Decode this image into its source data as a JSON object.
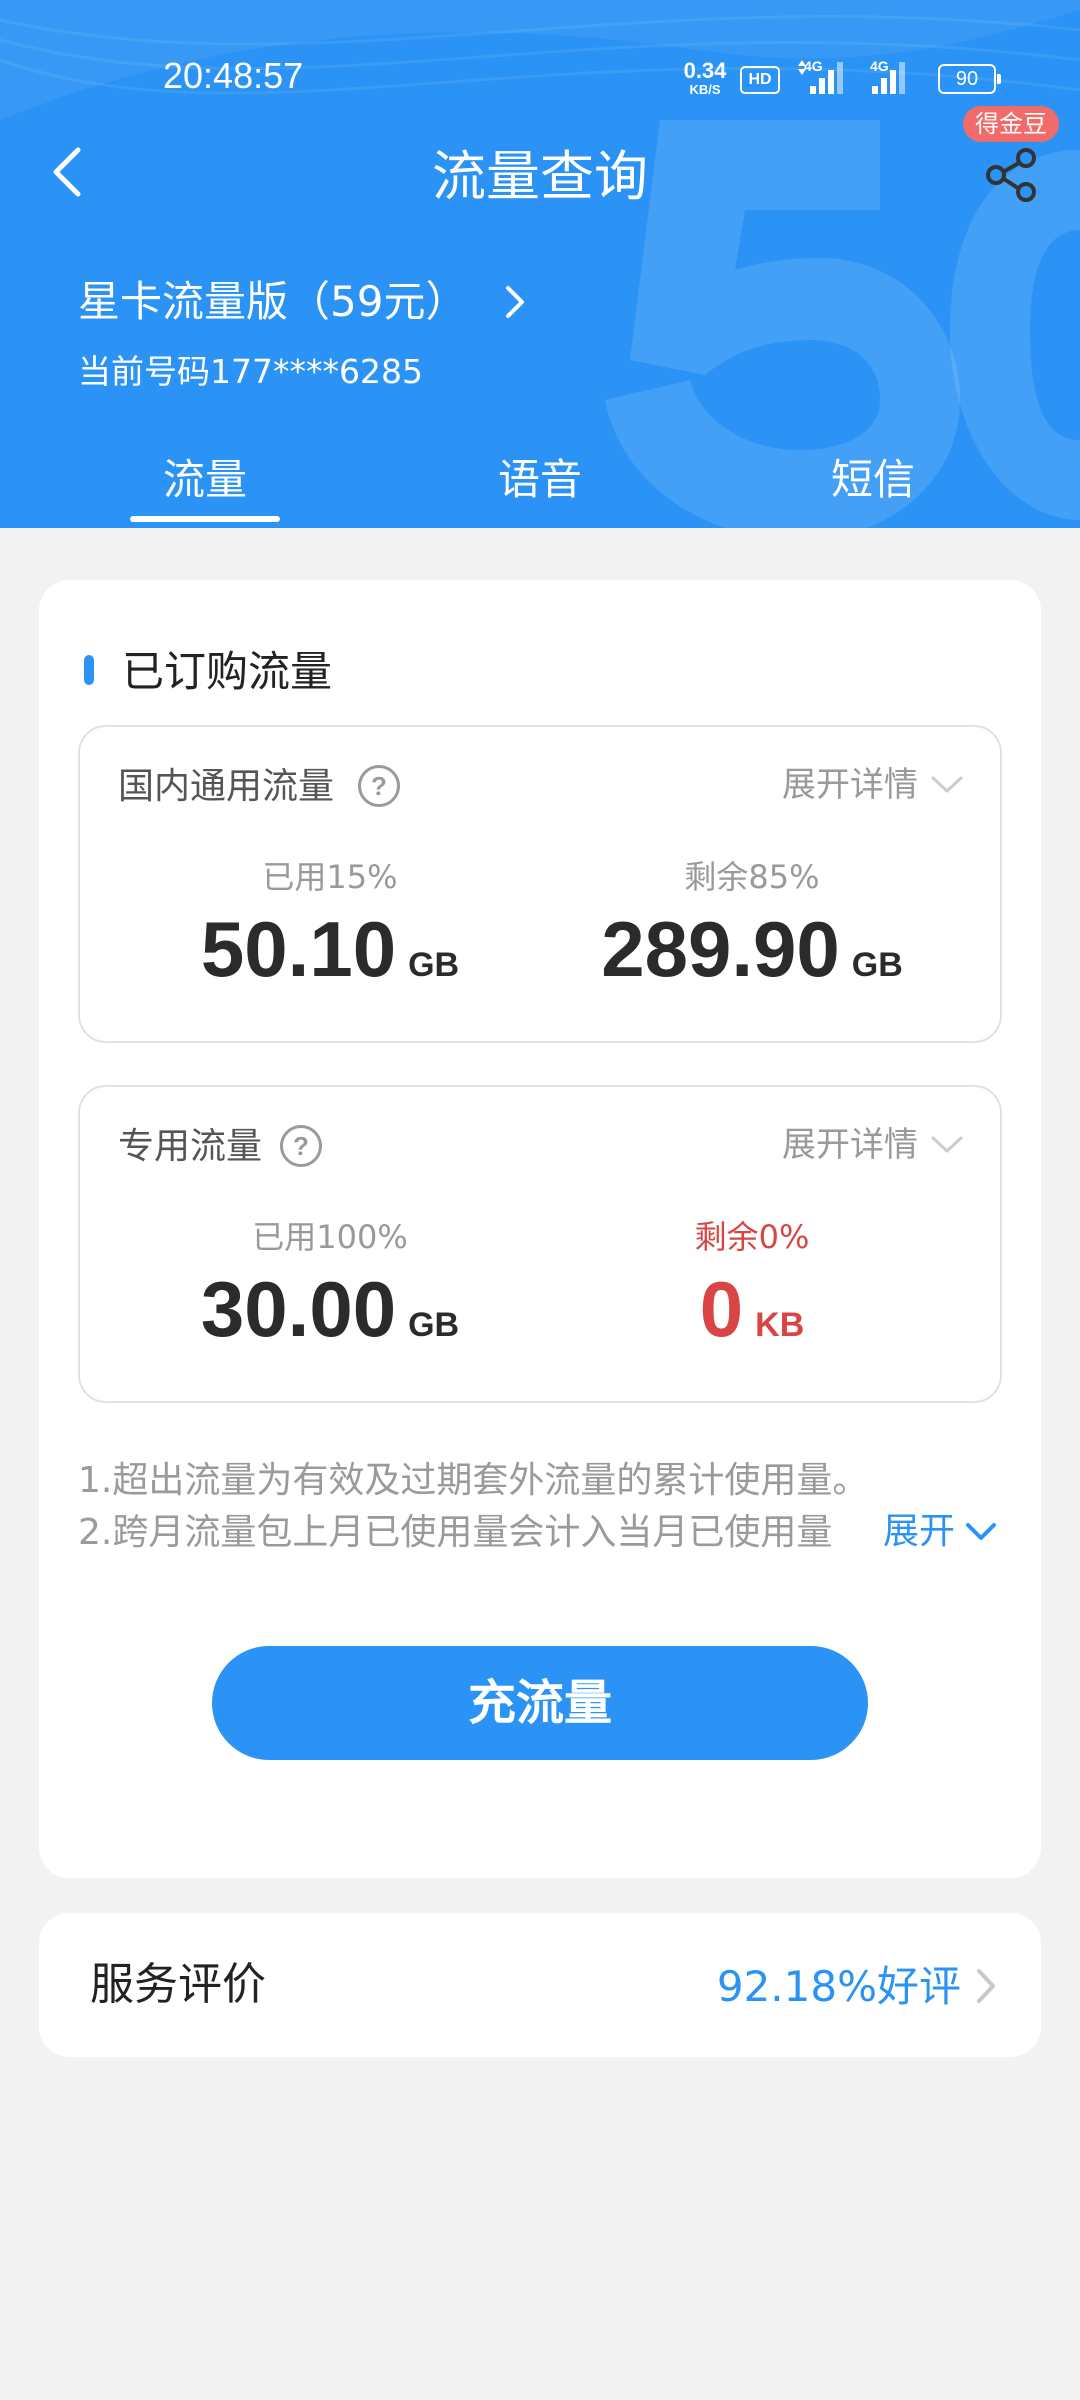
{
  "status_bar": {
    "time": "20:48:57",
    "net_speed_value": "0.34",
    "net_speed_unit": "KB/S",
    "hd_label": "HD",
    "signal_1_label": "4G",
    "signal_2_label": "4G",
    "battery": "90"
  },
  "header": {
    "title": "流量查询",
    "coin_badge": "得金豆",
    "plan_name": "星卡流量版（59元）",
    "phone_number": "当前号码177****6285",
    "tabs": [
      {
        "label": "流量",
        "active": true
      },
      {
        "label": "语音",
        "active": false
      },
      {
        "label": "短信",
        "active": false
      }
    ],
    "colors": {
      "primary": "#2b93f5",
      "badge": "#f26b6b"
    }
  },
  "subscribed": {
    "section_title": "已订购流量",
    "domestic": {
      "title": "国内通用流量",
      "expand_label": "展开详情",
      "used_label": "已用15%",
      "used_value": "50.10",
      "used_unit": "GB",
      "remaining_label": "剩余85%",
      "remaining_value": "289.90",
      "remaining_unit": "GB"
    },
    "dedicated": {
      "title": "专用流量",
      "expand_label": "展开详情",
      "used_label": "已用100%",
      "used_value": "30.00",
      "used_unit": "GB",
      "remaining_label": "剩余0%",
      "remaining_value": "0",
      "remaining_unit": "KB",
      "alert_color": "#d94545"
    }
  },
  "notes": {
    "line1": "1.超出流量为有效及过期套外流量的累计使用量。",
    "line2": "2.跨月流量包上月已使用量会计入当月已使用量",
    "expand_label": "展开"
  },
  "recharge_button": "充流量",
  "rating": {
    "title": "服务评价",
    "value": "92.18%好评"
  },
  "icons": [
    "back-icon",
    "share-icon",
    "help-icon",
    "chevron-down-icon",
    "chevron-right-icon",
    "signal-icon",
    "battery-icon"
  ]
}
